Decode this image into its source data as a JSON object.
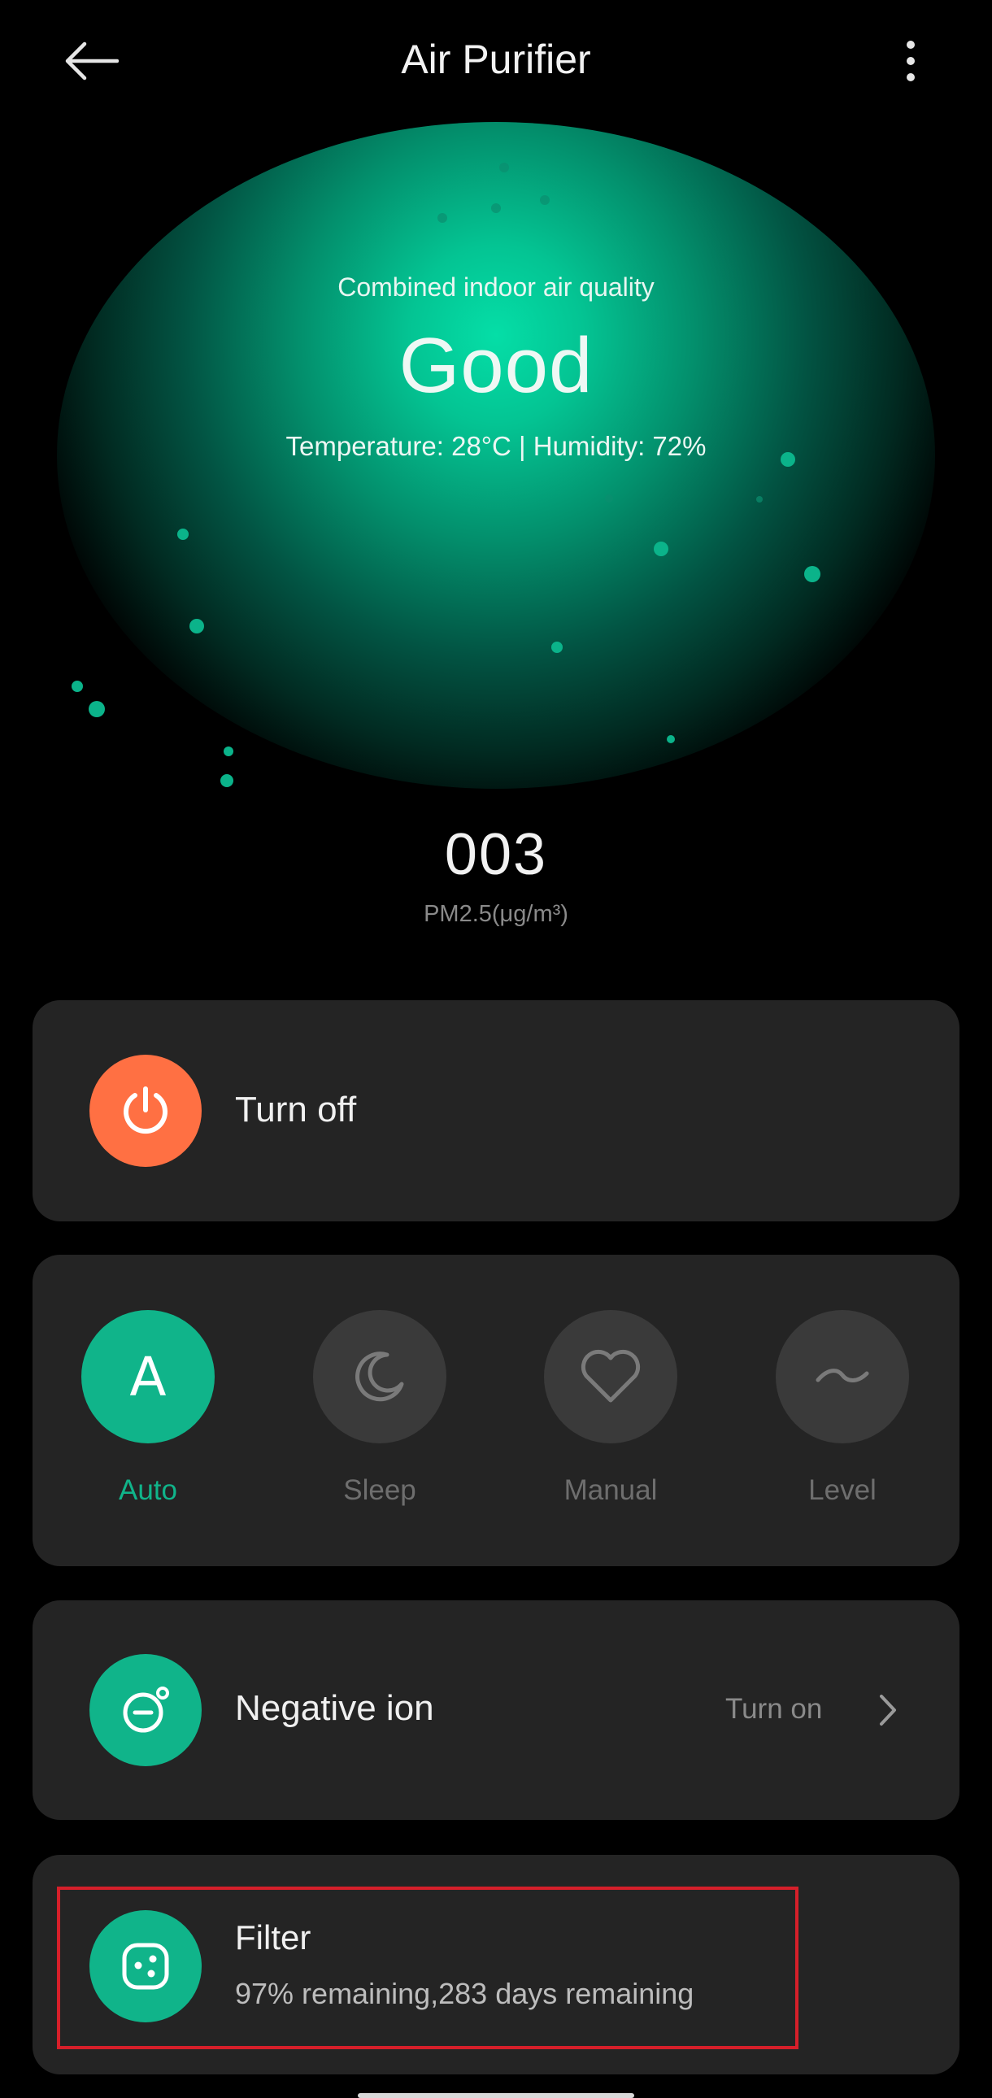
{
  "header": {
    "title": "Air Purifier"
  },
  "air_quality": {
    "label": "Combined indoor air quality",
    "value": "Good",
    "meta": "Temperature: 28°C | Humidity: 72%"
  },
  "pm25": {
    "value": "003",
    "unit": "PM2.5(μg/m³)"
  },
  "power": {
    "label": "Turn off",
    "color": "#ff7043"
  },
  "modes": [
    {
      "label": "Auto",
      "icon": "letter-a-icon",
      "active": true
    },
    {
      "label": "Sleep",
      "icon": "moon-icon",
      "active": false
    },
    {
      "label": "Manual",
      "icon": "heart-icon",
      "active": false
    },
    {
      "label": "Level",
      "icon": "tilde-icon",
      "active": false
    }
  ],
  "negative_ion": {
    "label": "Negative ion",
    "action": "Turn on"
  },
  "filter": {
    "label": "Filter",
    "status": "97% remaining,283 days remaining"
  },
  "colors": {
    "accent": "#10b48a",
    "card": "#242424",
    "background": "#000000",
    "highlight": "#d61f2a"
  }
}
